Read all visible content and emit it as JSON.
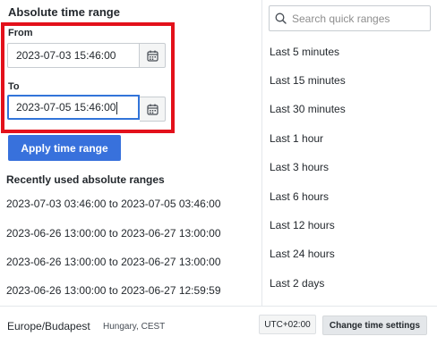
{
  "absolute": {
    "title": "Absolute time range",
    "from_label": "From",
    "from_value": "2023-07-03 15:46:00",
    "to_label": "To",
    "to_value": "2023-07-05 15:46:00",
    "apply_label": "Apply time range"
  },
  "recent": {
    "title": "Recently used absolute ranges",
    "items": [
      "2023-07-03 03:46:00 to 2023-07-05 03:46:00",
      "2023-06-26 13:00:00 to 2023-06-27 13:00:00",
      "2023-06-26 13:00:00 to 2023-06-27 13:00:00",
      "2023-06-26 13:00:00 to 2023-06-27 12:59:59"
    ]
  },
  "quick": {
    "search_placeholder": "Search quick ranges",
    "items": [
      "Last 5 minutes",
      "Last 15 minutes",
      "Last 30 minutes",
      "Last 1 hour",
      "Last 3 hours",
      "Last 6 hours",
      "Last 12 hours",
      "Last 24 hours",
      "Last 2 days"
    ]
  },
  "footer": {
    "timezone": "Europe/Budapest",
    "timezone_detail": "Hungary, CEST",
    "utc_offset": "UTC+02:00",
    "settings_label": "Change time settings"
  },
  "icons": {
    "calendar": "calendar-icon",
    "search": "search-icon"
  },
  "colors": {
    "primary": "#3871dc",
    "highlight": "#e3111b",
    "focus": "#3274d9"
  }
}
